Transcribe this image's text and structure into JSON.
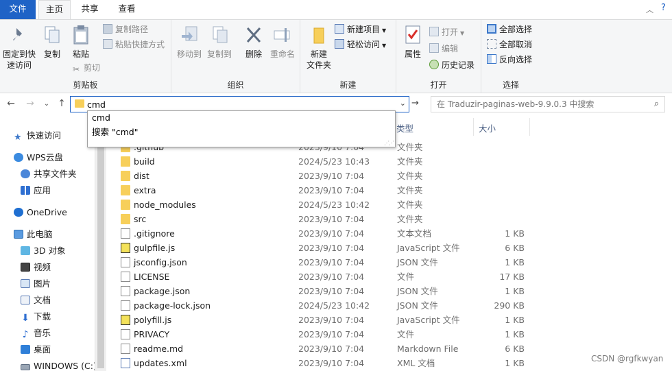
{
  "tabs": {
    "file": "文件",
    "home": "主页",
    "share": "共享",
    "view": "查看"
  },
  "ribbon": {
    "clipboard": {
      "pin": "固定到快\n速访问",
      "copy": "复制",
      "paste": "粘贴",
      "copy_path": "复制路径",
      "paste_shortcut": "粘贴快捷方式",
      "cut": "剪切",
      "label": "剪贴板"
    },
    "organize": {
      "move_to": "移动到",
      "copy_to": "复制到",
      "delete": "删除",
      "rename": "重命名",
      "label": "组织"
    },
    "new": {
      "new_folder": "新建\n文件夹",
      "new_item": "新建项目",
      "easy_access": "轻松访问",
      "label": "新建"
    },
    "open": {
      "properties": "属性",
      "open": "打开",
      "edit": "编辑",
      "history": "历史记录",
      "label": "打开"
    },
    "select": {
      "select_all": "全部选择",
      "select_none": "全部取消",
      "invert": "反向选择",
      "label": "选择"
    }
  },
  "address": {
    "value": "cmd"
  },
  "search": {
    "placeholder": "在 Traduzir-paginas-web-9.9.0.3 中搜索"
  },
  "autocomplete": {
    "item1": "cmd",
    "item2": "搜索 \"cmd\""
  },
  "columns": {
    "type": "类型",
    "size": "大小"
  },
  "sidebar": {
    "items": [
      "快速访问",
      "WPS云盘",
      "共享文件夹",
      "应用",
      "OneDrive",
      "此电脑",
      "3D 对象",
      "视频",
      "图片",
      "文档",
      "下载",
      "音乐",
      "桌面",
      "WINDOWS (C:)"
    ]
  },
  "files": [
    {
      "name": ".github",
      "date": "2023/9/10 7:04",
      "type": "文件夹",
      "size": "",
      "icon": "folder-icon"
    },
    {
      "name": "build",
      "date": "2024/5/23 10:43",
      "type": "文件夹",
      "size": "",
      "icon": "folder-icon"
    },
    {
      "name": "dist",
      "date": "2023/9/10 7:04",
      "type": "文件夹",
      "size": "",
      "icon": "folder-icon"
    },
    {
      "name": "extra",
      "date": "2023/9/10 7:04",
      "type": "文件夹",
      "size": "",
      "icon": "folder-icon"
    },
    {
      "name": "node_modules",
      "date": "2024/5/23 10:42",
      "type": "文件夹",
      "size": "",
      "icon": "folder-icon"
    },
    {
      "name": "src",
      "date": "2023/9/10 7:04",
      "type": "文件夹",
      "size": "",
      "icon": "folder-icon"
    },
    {
      "name": ".gitignore",
      "date": "2023/9/10 7:04",
      "type": "文本文档",
      "size": "1 KB",
      "icon": "text-file-icon"
    },
    {
      "name": "gulpfile.js",
      "date": "2023/9/10 7:04",
      "type": "JavaScript 文件",
      "size": "6 KB",
      "icon": "js-file-icon"
    },
    {
      "name": "jsconfig.json",
      "date": "2023/9/10 7:04",
      "type": "JSON 文件",
      "size": "1 KB",
      "icon": "file-icon"
    },
    {
      "name": "LICENSE",
      "date": "2023/9/10 7:04",
      "type": "文件",
      "size": "17 KB",
      "icon": "file-icon"
    },
    {
      "name": "package.json",
      "date": "2023/9/10 7:04",
      "type": "JSON 文件",
      "size": "1 KB",
      "icon": "file-icon"
    },
    {
      "name": "package-lock.json",
      "date": "2024/5/23 10:42",
      "type": "JSON 文件",
      "size": "290 KB",
      "icon": "file-icon"
    },
    {
      "name": "polyfill.js",
      "date": "2023/9/10 7:04",
      "type": "JavaScript 文件",
      "size": "1 KB",
      "icon": "js-file-icon"
    },
    {
      "name": "PRIVACY",
      "date": "2023/9/10 7:04",
      "type": "文件",
      "size": "1 KB",
      "icon": "file-icon"
    },
    {
      "name": "readme.md",
      "date": "2023/9/10 7:04",
      "type": "Markdown File",
      "size": "6 KB",
      "icon": "file-icon"
    },
    {
      "name": "updates.xml",
      "date": "2023/9/10 7:04",
      "type": "XML 文档",
      "size": "1 KB",
      "icon": "xml-file-icon"
    }
  ],
  "watermark": "CSDN @rgfkwyan",
  "colors": {
    "accent": "#1f63c6",
    "folder": "#f7cf5a",
    "ribbon_bg": "#f5f6f7"
  }
}
